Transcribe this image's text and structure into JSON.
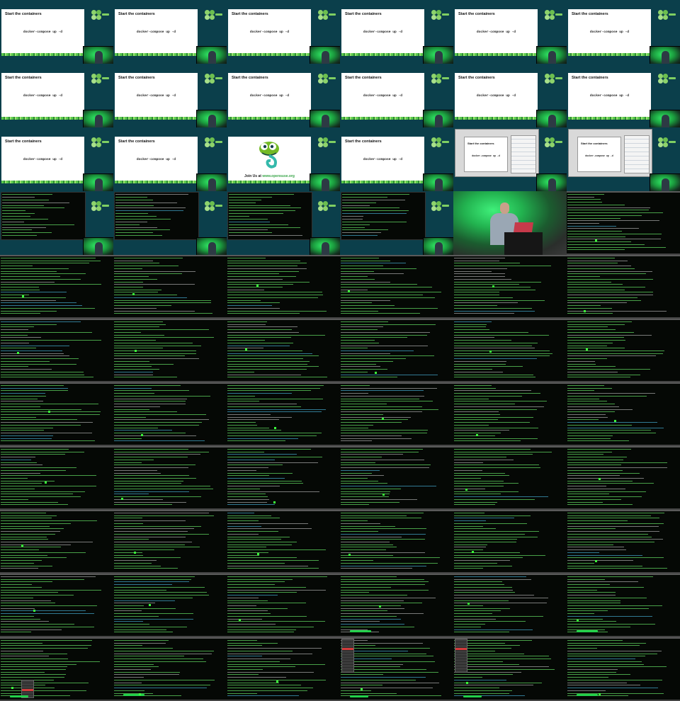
{
  "slide": {
    "title": "Start the containers",
    "command": "docker-compose up -d"
  },
  "join": {
    "prefix": "Join Us at ",
    "site": "www.opensuse.org"
  },
  "colors": {
    "slide_bg": "#0b3f4b",
    "terminal_bg": "#050805",
    "terminal_text": "#5fd35f",
    "accent_green": "#22d04a"
  },
  "icons": [
    "opensuse-logo-icon",
    "chameleon-mascot-icon",
    "speaker-inset-icon"
  ]
}
